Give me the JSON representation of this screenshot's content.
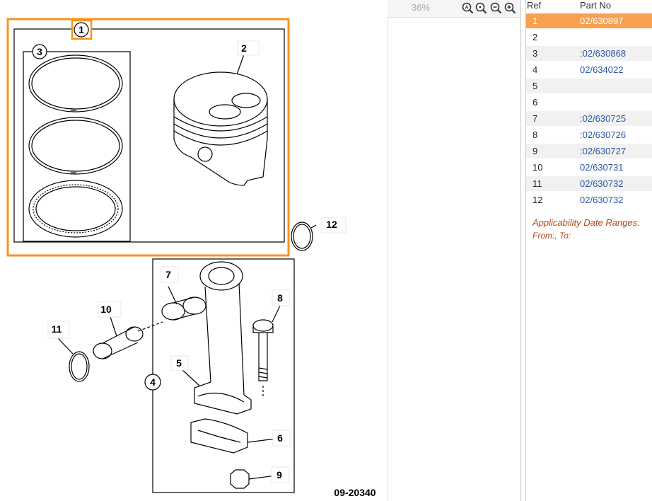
{
  "toolbar": {
    "zoom_level": "36%",
    "icons": [
      "zoom-auto-icon",
      "zoom-fit-icon",
      "zoom-out-icon",
      "zoom-in-icon"
    ]
  },
  "diagram": {
    "drawing_number": "09-20340",
    "callouts": [
      "1",
      "2",
      "3",
      "4",
      "5",
      "6",
      "7",
      "8",
      "9",
      "10",
      "11",
      "12"
    ],
    "highlight_color": "#f7941d"
  },
  "parts_table": {
    "headers": {
      "ref": "Ref",
      "part_no": "Part No"
    },
    "rows": [
      {
        "ref": "1",
        "part_no": "02/630897",
        "selected": true
      },
      {
        "ref": "2",
        "part_no": ""
      },
      {
        "ref": "3",
        "part_no": ":02/630868"
      },
      {
        "ref": "4",
        "part_no": "02/634022"
      },
      {
        "ref": "5",
        "part_no": ""
      },
      {
        "ref": "6",
        "part_no": ""
      },
      {
        "ref": "7",
        "part_no": ":02/630725"
      },
      {
        "ref": "8",
        "part_no": ":02/630726"
      },
      {
        "ref": "9",
        "part_no": ":02/630727"
      },
      {
        "ref": "10",
        "part_no": "02/630731"
      },
      {
        "ref": "11",
        "part_no": "02/630732"
      },
      {
        "ref": "12",
        "part_no": "02/630732"
      }
    ],
    "selected_color": "#f7a04f",
    "link_color": "#2a56a4"
  },
  "applicability": {
    "title": "Applicability Date Ranges:",
    "value": "From:, To:"
  }
}
